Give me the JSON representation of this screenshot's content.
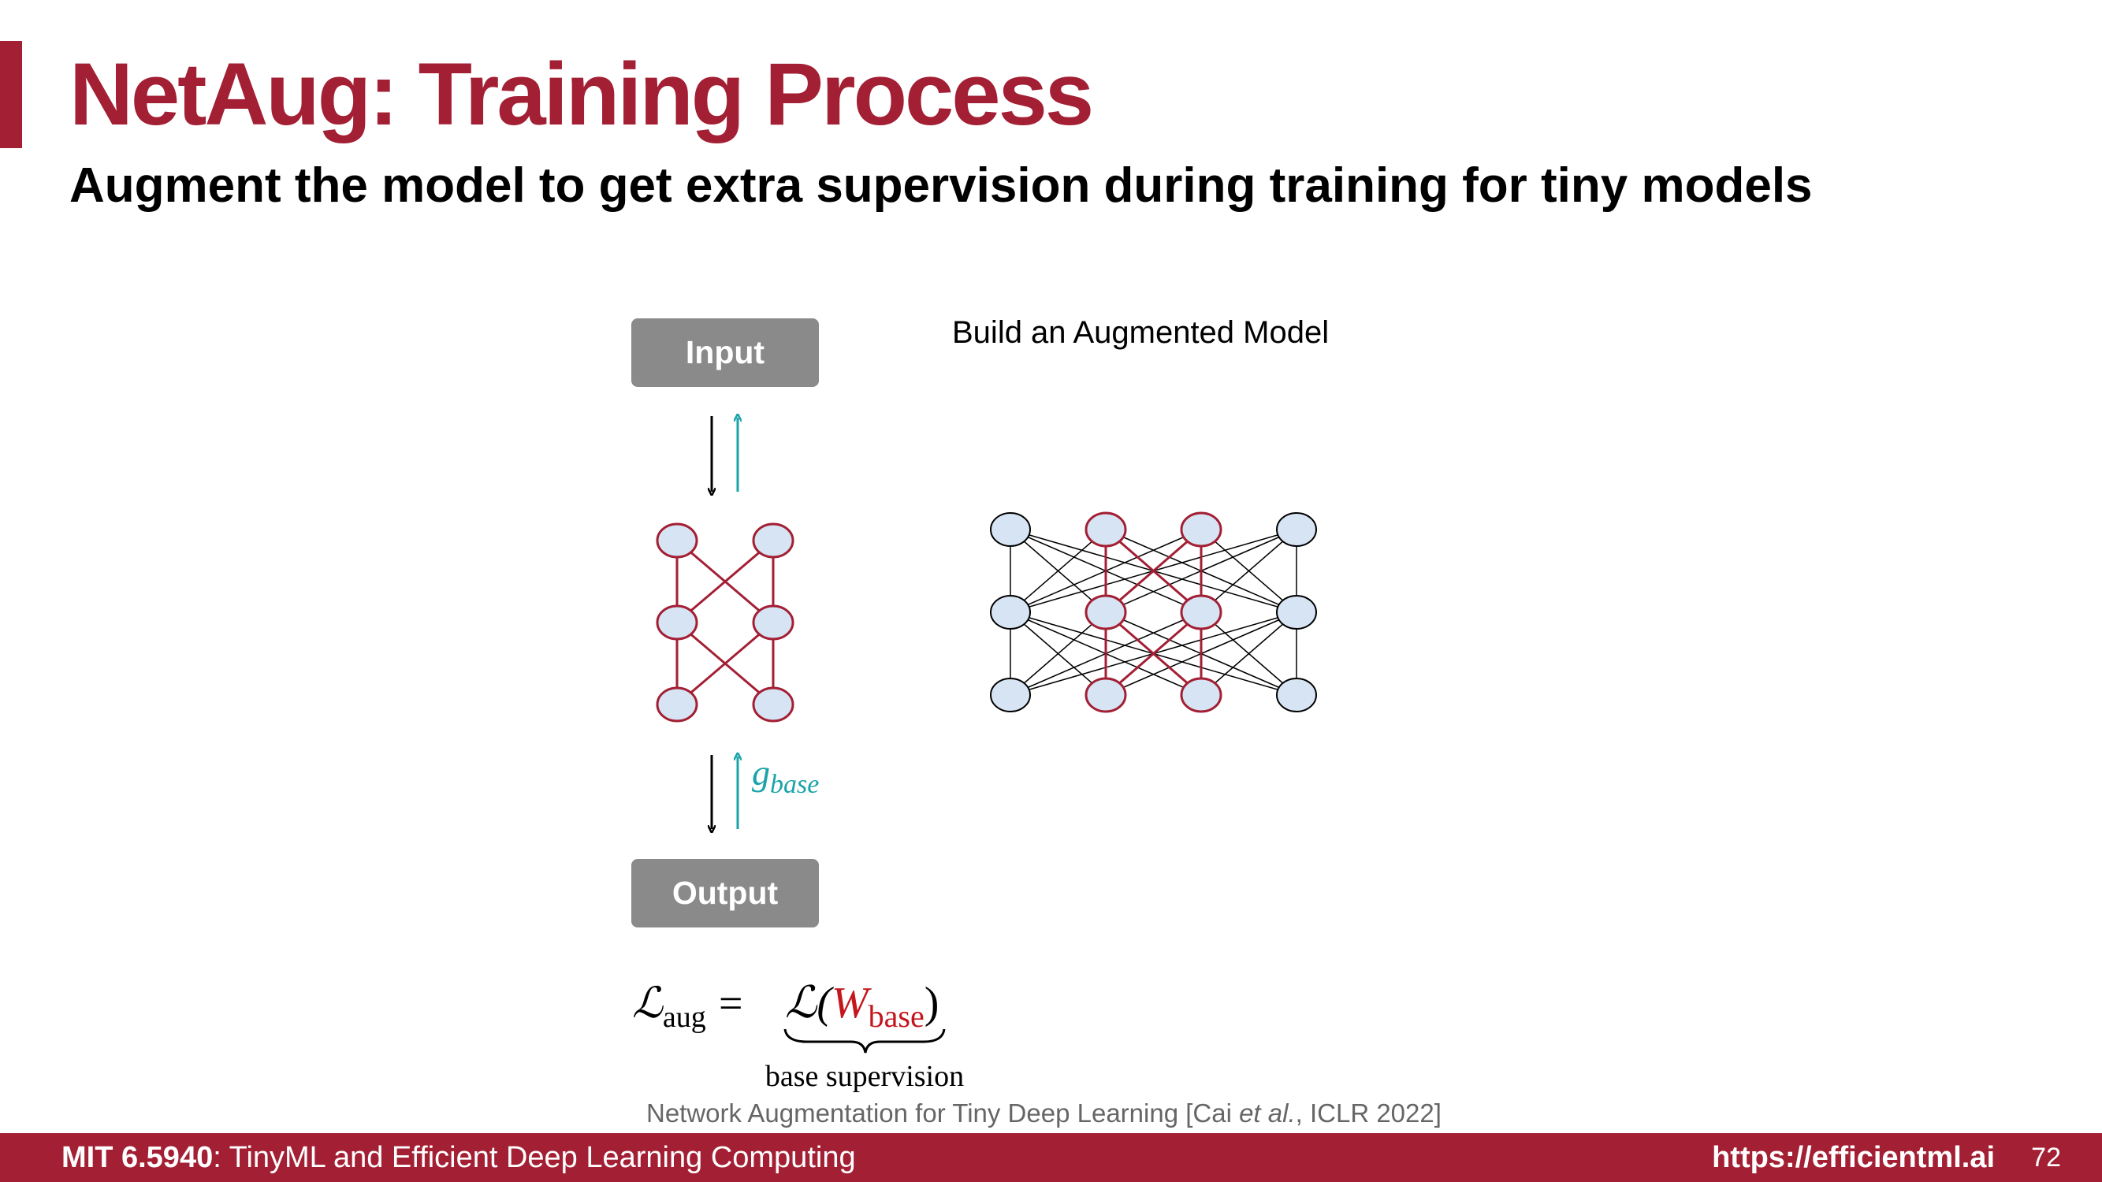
{
  "slide": {
    "title": "NetAug: Training Process",
    "subtitle": "Augment the model to get extra supervision during training for tiny models",
    "input_label": "Input",
    "output_label": "Output",
    "augmented_label": "Build an Augmented Model",
    "gradient_label": "g",
    "gradient_subscript": "base",
    "formula": {
      "lhs": "ℒ",
      "lhs_sub": "aug",
      "equals": "=",
      "rhs_loss": "ℒ(",
      "rhs_weight": "W",
      "rhs_weight_sub": "base",
      "rhs_close": ")",
      "brace_label": "base supervision"
    },
    "citation": {
      "prefix": "Network Augmentation for Tiny Deep Learning [Cai ",
      "etal": "et al.",
      "suffix": ", ICLR 2022]"
    }
  },
  "footer": {
    "course_code": "MIT 6.5940",
    "course_name": ": TinyML and Efficient Deep Learning Computing",
    "url": "https://efficientml.ai",
    "page_number": "72"
  },
  "colors": {
    "accent": "#a31f34",
    "node_fill": "#d6e4f3",
    "gradient": "#1aa3a8",
    "box": "#8a8a8a"
  }
}
